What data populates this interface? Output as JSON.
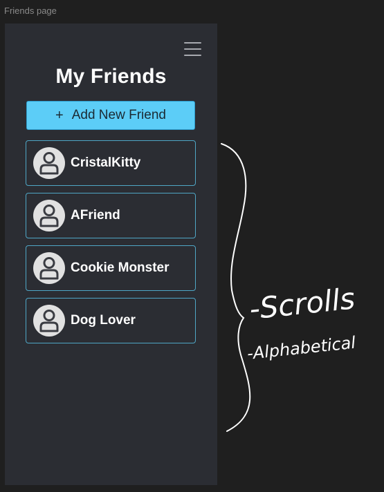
{
  "canvas": {
    "frame_label": "Friends page"
  },
  "header": {
    "title": "My Friends",
    "menu_icon": "hamburger-menu-icon"
  },
  "actions": {
    "add_friend_icon": "+",
    "add_friend_label": "Add New Friend"
  },
  "friends": [
    {
      "name": "CristalKitty",
      "avatar_icon": "user-avatar-icon"
    },
    {
      "name": "AFriend",
      "avatar_icon": "user-avatar-icon"
    },
    {
      "name": "Cookie Monster",
      "avatar_icon": "user-avatar-icon"
    },
    {
      "name": "Dog Lover",
      "avatar_icon": "user-avatar-icon"
    }
  ],
  "annotations": {
    "scrolls": "-Scrolls",
    "alphabetical": "-Alphabetical"
  },
  "colors": {
    "background": "#1f1f1f",
    "phone_background": "#2b2d33",
    "accent": "#5ccdf7",
    "card_border": "#4fa7c7",
    "avatar_background": "#e1e1e1"
  }
}
